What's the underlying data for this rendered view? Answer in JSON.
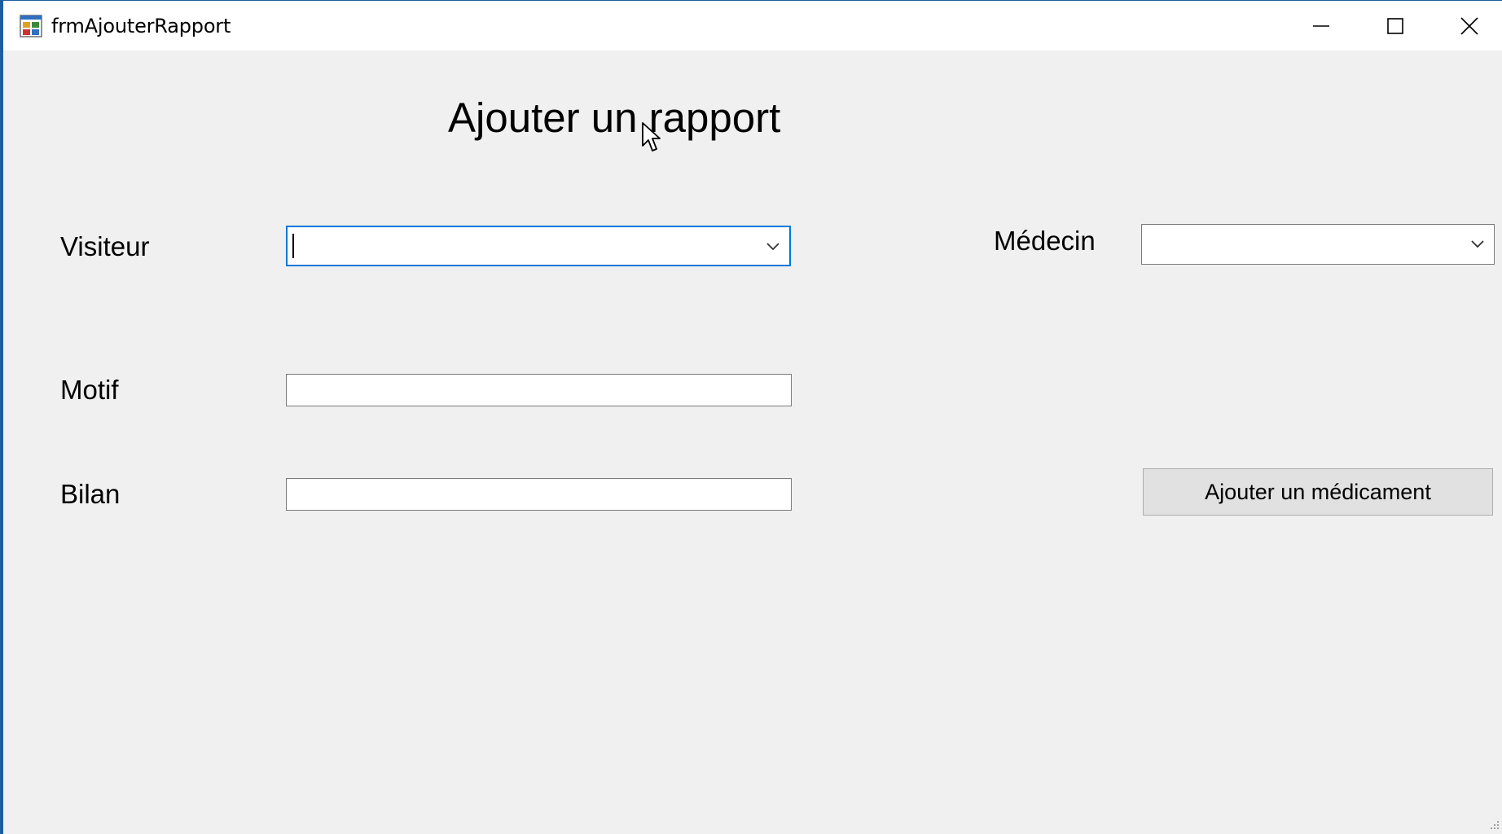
{
  "window": {
    "title": "frmAjouterRapport",
    "icon": "winforms-app-icon",
    "controls": {
      "minimize": "minimize-icon",
      "maximize": "maximize-icon",
      "close": "close-icon"
    }
  },
  "form": {
    "heading": "Ajouter un rapport",
    "visiteur": {
      "label": "Visiteur",
      "value": ""
    },
    "medecin": {
      "label": "Médecin",
      "value": ""
    },
    "motif": {
      "label": "Motif",
      "value": ""
    },
    "bilan": {
      "label": "Bilan",
      "value": ""
    },
    "add_medicament_button": "Ajouter un médicament"
  },
  "colors": {
    "form_background": "#f0f0f0",
    "titlebar_background": "#ffffff",
    "focus_border": "#0078d7",
    "window_border": "#1a5f9e",
    "button_background": "#e1e1e1"
  }
}
